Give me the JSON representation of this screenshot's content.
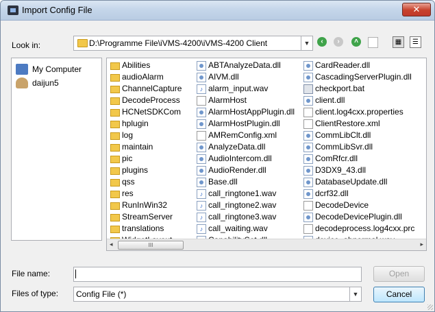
{
  "window": {
    "title": "Import Config File",
    "close_glyph": "✕",
    "background": "#f0f0f0"
  },
  "toolbar": {
    "look_in_label": "Look in:",
    "path": "D:\\Programme File\\iVMS-4200\\iVMS-4200 Client",
    "icons": [
      "back-icon",
      "forward-icon",
      "up-icon",
      "new-folder-icon",
      "detail-view-icon",
      "list-view-icon"
    ]
  },
  "sidebar": {
    "items": [
      {
        "label": "My Computer",
        "icon": "computer-icon"
      },
      {
        "label": "daijun5",
        "icon": "user-icon"
      }
    ]
  },
  "files": {
    "columns": [
      [
        {
          "name": "Abilities",
          "type": "folder"
        },
        {
          "name": "audioAlarm",
          "type": "folder"
        },
        {
          "name": "ChannelCapture",
          "type": "folder"
        },
        {
          "name": "DecodeProcess",
          "type": "folder"
        },
        {
          "name": "HCNetSDKCom",
          "type": "folder"
        },
        {
          "name": "hplugin",
          "type": "folder"
        },
        {
          "name": "log",
          "type": "folder"
        },
        {
          "name": "maintain",
          "type": "folder"
        },
        {
          "name": "pic",
          "type": "folder"
        },
        {
          "name": "plugins",
          "type": "folder"
        },
        {
          "name": "qss",
          "type": "folder"
        },
        {
          "name": "res",
          "type": "folder"
        },
        {
          "name": "RunInWin32",
          "type": "folder"
        },
        {
          "name": "StreamServer",
          "type": "folder"
        },
        {
          "name": "translations",
          "type": "folder"
        },
        {
          "name": "WidgetLayout",
          "type": "folder"
        }
      ],
      [
        {
          "name": "ABTAnalyzeData.dll",
          "type": "dll"
        },
        {
          "name": "AIVM.dll",
          "type": "dll"
        },
        {
          "name": "alarm_input.wav",
          "type": "wav"
        },
        {
          "name": "AlarmHost",
          "type": "doc"
        },
        {
          "name": "AlarmHostAppPlugin.dll",
          "type": "dll"
        },
        {
          "name": "AlarmHostPlugin.dll",
          "type": "dll"
        },
        {
          "name": "AMRemConfig.xml",
          "type": "doc"
        },
        {
          "name": "AnalyzeData.dll",
          "type": "dll"
        },
        {
          "name": "AudioIntercom.dll",
          "type": "dll"
        },
        {
          "name": "AudioRender.dll",
          "type": "dll"
        },
        {
          "name": "Base.dll",
          "type": "dll"
        },
        {
          "name": "call_ringtone1.wav",
          "type": "wav"
        },
        {
          "name": "call_ringtone2.wav",
          "type": "wav"
        },
        {
          "name": "call_ringtone3.wav",
          "type": "wav"
        },
        {
          "name": "call_waiting.wav",
          "type": "wav"
        },
        {
          "name": "CapabilitySet.dll",
          "type": "dll"
        }
      ],
      [
        {
          "name": "CardReader.dll",
          "type": "dll"
        },
        {
          "name": "CascadingServerPlugin.dll",
          "type": "dll"
        },
        {
          "name": "checkport.bat",
          "type": "bat"
        },
        {
          "name": "client.dll",
          "type": "dll"
        },
        {
          "name": "client.log4cxx.properties",
          "type": "doc"
        },
        {
          "name": "ClientRestore.xml",
          "type": "doc"
        },
        {
          "name": "CommLibClt.dll",
          "type": "dll"
        },
        {
          "name": "CommLibSvr.dll",
          "type": "dll"
        },
        {
          "name": "ComRfcr.dll",
          "type": "dll"
        },
        {
          "name": "D3DX9_43.dll",
          "type": "dll"
        },
        {
          "name": "DatabaseUpdate.dll",
          "type": "dll"
        },
        {
          "name": "dcrf32.dll",
          "type": "dll"
        },
        {
          "name": "DecodeDevice",
          "type": "doc"
        },
        {
          "name": "DecodeDevicePlugin.dll",
          "type": "dll"
        },
        {
          "name": "decodeprocess.log4cxx.prc",
          "type": "doc"
        },
        {
          "name": "device_abnormal.wav",
          "type": "wav"
        }
      ]
    ],
    "scroll_left": "◂",
    "scroll_right": "▸",
    "scroll_thumb_grip": "III"
  },
  "filename": {
    "label": "File name:",
    "value": ""
  },
  "filetype": {
    "label": "Files of type:",
    "value": "Config File (*)"
  },
  "buttons": {
    "open": "Open",
    "cancel": "Cancel"
  },
  "colors": {
    "accent": "#3c7fb1",
    "folder": "#f2c84b",
    "close": "#c7412b"
  }
}
